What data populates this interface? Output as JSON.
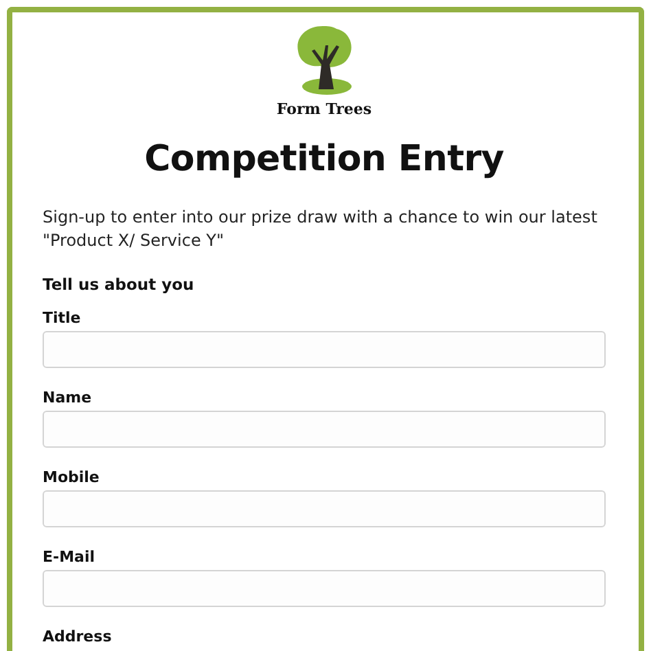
{
  "logo": {
    "name": "Form Trees"
  },
  "title": "Competition Entry",
  "intro": "Sign-up to enter into our prize draw with a chance to  win our latest \"Product X/ Service Y\"",
  "section": "Tell us about you",
  "fields": [
    {
      "label": "Title",
      "kind": "input"
    },
    {
      "label": "Name",
      "kind": "input"
    },
    {
      "label": "Mobile",
      "kind": "input"
    },
    {
      "label": "E-Mail",
      "kind": "input"
    },
    {
      "label": "Address",
      "kind": "label"
    }
  ]
}
